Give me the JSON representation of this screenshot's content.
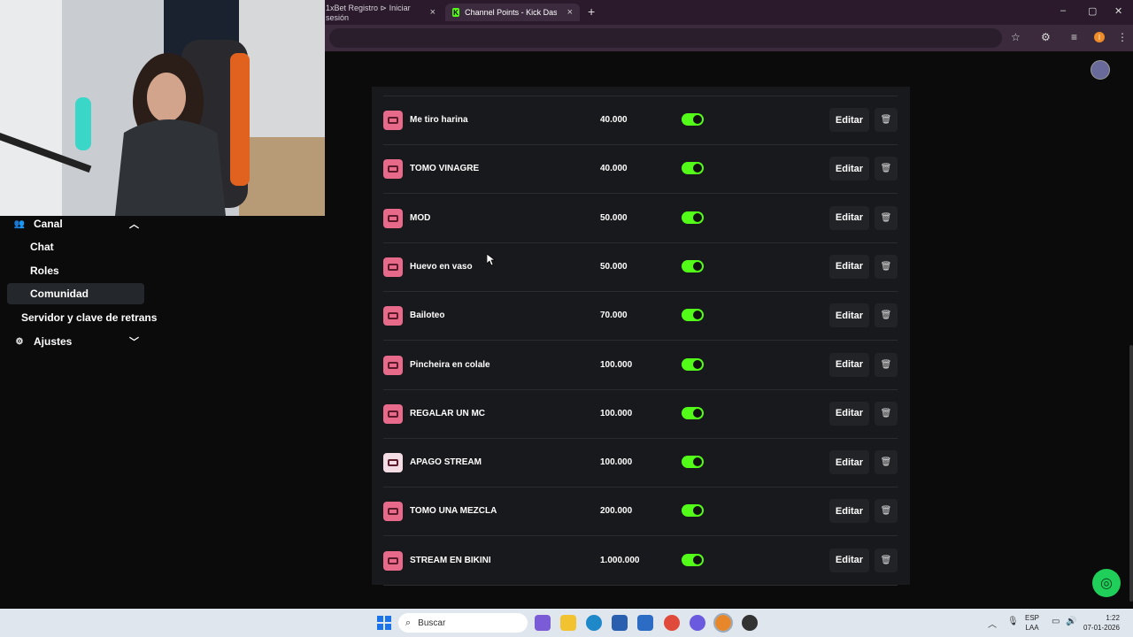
{
  "browser": {
    "tabs": [
      {
        "label": "1xBet Registro ⊳ Iniciar sesión"
      },
      {
        "label": "Channel Points - Kick Dashboar",
        "favicon": "K"
      }
    ],
    "new_tab": "+",
    "window_controls": [
      "–",
      "▢",
      "✕"
    ]
  },
  "sidebar": {
    "items": [
      {
        "label": "Canal",
        "icon": "users-icon",
        "expanded": true
      },
      {
        "label": "Chat"
      },
      {
        "label": "Roles"
      },
      {
        "label": "Comunidad",
        "active": true
      },
      {
        "label": "Servidor y clave de retrans"
      },
      {
        "label": "Ajustes",
        "icon": "gear-icon",
        "expanded": false
      }
    ]
  },
  "rewards": {
    "edit_label": "Editar",
    "rows": [
      {
        "name": "Me tiro harina",
        "cost": "40.000",
        "enabled": true
      },
      {
        "name": "TOMO VINAGRE",
        "cost": "40.000",
        "enabled": true
      },
      {
        "name": "MOD",
        "cost": "50.000",
        "enabled": true
      },
      {
        "name": "Huevo en vaso",
        "cost": "50.000",
        "enabled": true
      },
      {
        "name": "Bailoteo",
        "cost": "70.000",
        "enabled": true
      },
      {
        "name": "Pincheira en colale",
        "cost": "100.000",
        "enabled": true
      },
      {
        "name": "REGALAR UN MC",
        "cost": "100.000",
        "enabled": true
      },
      {
        "name": "APAGO STREAM",
        "cost": "100.000",
        "enabled": true
      },
      {
        "name": "TOMO UNA MEZCLA",
        "cost": "200.000",
        "enabled": true
      },
      {
        "name": "STREAM EN BIKINI",
        "cost": "1.000.000",
        "enabled": true
      }
    ]
  },
  "colors": {
    "accent": "#53fc18",
    "panel": "#18191c",
    "reward_icon": "#e86a8a"
  },
  "taskbar": {
    "search_placeholder": "Buscar",
    "lang_line1": "ESP",
    "lang_line2": "LAA",
    "time": "1:22",
    "date": "07-01-2026"
  }
}
